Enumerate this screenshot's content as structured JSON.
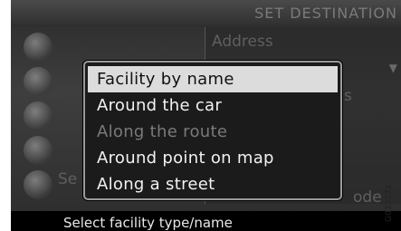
{
  "header": {
    "title": "SET DESTINATION"
  },
  "background": {
    "address_label": "Address",
    "partial_ns": "s",
    "partial_se": "Se",
    "partial_ode": "ode"
  },
  "popup_menu": {
    "items": [
      {
        "label": "Facility by name",
        "selected": true,
        "enabled": true
      },
      {
        "label": "Around the car",
        "selected": false,
        "enabled": true
      },
      {
        "label": "Along the route",
        "selected": false,
        "enabled": false
      },
      {
        "label": "Around point on map",
        "selected": false,
        "enabled": true
      },
      {
        "label": "Along a street",
        "selected": false,
        "enabled": true
      }
    ]
  },
  "status_bar": {
    "text": "Select facility type/name"
  },
  "image_code": "G032272"
}
